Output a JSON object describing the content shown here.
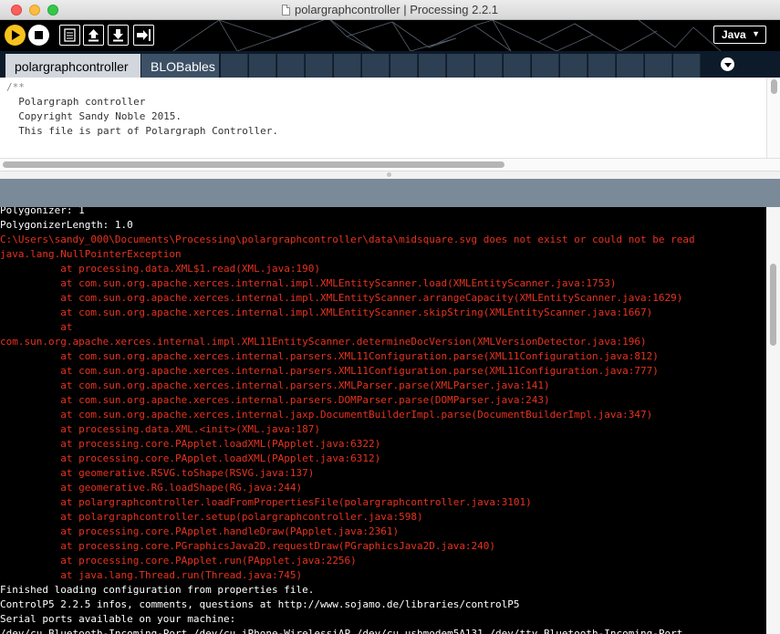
{
  "window": {
    "title": "polargraphcontroller | Processing 2.2.1"
  },
  "toolbar": {
    "run_icon": "run-icon",
    "stop_icon": "stop-icon",
    "new_icon": "new-file-icon",
    "open_icon": "open-arrow-icon",
    "save_icon": "save-arrow-icon",
    "export_icon": "export-icon",
    "mode": "Java",
    "accent": "#f7c21c"
  },
  "tabs": [
    {
      "label": "polargraphcontroller",
      "active": true
    },
    {
      "label": "BLOBables",
      "active": false
    }
  ],
  "editor": {
    "lines": [
      "/**",
      "  Polargraph controller",
      "  Copyright Sandy Noble 2015.",
      "",
      "  This file is part of Polargraph Controller."
    ]
  },
  "console": {
    "lines": [
      {
        "type": "out",
        "text": "Polygonizer: 1"
      },
      {
        "type": "out",
        "text": "PolygonizerLength: 1.0"
      },
      {
        "type": "err",
        "text": "C:\\Users\\sandy_000\\Documents\\Processing\\polargraphcontroller\\data\\midsquare.svg does not exist or could not be read"
      },
      {
        "type": "err",
        "text": "java.lang.NullPointerException"
      },
      {
        "type": "err",
        "text": "          at processing.data.XML$1.read(XML.java:190)"
      },
      {
        "type": "err",
        "text": "          at com.sun.org.apache.xerces.internal.impl.XMLEntityScanner.load(XMLEntityScanner.java:1753)"
      },
      {
        "type": "err",
        "text": "          at com.sun.org.apache.xerces.internal.impl.XMLEntityScanner.arrangeCapacity(XMLEntityScanner.java:1629)"
      },
      {
        "type": "err",
        "text": "          at com.sun.org.apache.xerces.internal.impl.XMLEntityScanner.skipString(XMLEntityScanner.java:1667)"
      },
      {
        "type": "err",
        "text": "          at"
      },
      {
        "type": "err",
        "text": "com.sun.org.apache.xerces.internal.impl.XML11EntityScanner.determineDocVersion(XMLVersionDetector.java:196)"
      },
      {
        "type": "err",
        "text": "          at com.sun.org.apache.xerces.internal.parsers.XML11Configuration.parse(XML11Configuration.java:812)"
      },
      {
        "type": "err",
        "text": "          at com.sun.org.apache.xerces.internal.parsers.XML11Configuration.parse(XML11Configuration.java:777)"
      },
      {
        "type": "err",
        "text": "          at com.sun.org.apache.xerces.internal.parsers.XMLParser.parse(XMLParser.java:141)"
      },
      {
        "type": "err",
        "text": "          at com.sun.org.apache.xerces.internal.parsers.DOMParser.parse(DOMParser.java:243)"
      },
      {
        "type": "err",
        "text": "          at com.sun.org.apache.xerces.internal.jaxp.DocumentBuilderImpl.parse(DocumentBuilderImpl.java:347)"
      },
      {
        "type": "err",
        "text": "          at processing.data.XML.<init>(XML.java:187)"
      },
      {
        "type": "err",
        "text": "          at processing.core.PApplet.loadXML(PApplet.java:6322)"
      },
      {
        "type": "err",
        "text": "          at processing.core.PApplet.loadXML(PApplet.java:6312)"
      },
      {
        "type": "err",
        "text": "          at geomerative.RSVG.toShape(RSVG.java:137)"
      },
      {
        "type": "err",
        "text": "          at geomerative.RG.loadShape(RG.java:244)"
      },
      {
        "type": "err",
        "text": "          at polargraphcontroller.loadFromPropertiesFile(polargraphcontroller.java:3101)"
      },
      {
        "type": "err",
        "text": "          at polargraphcontroller.setup(polargraphcontroller.java:598)"
      },
      {
        "type": "err",
        "text": "          at processing.core.PApplet.handleDraw(PApplet.java:2361)"
      },
      {
        "type": "err",
        "text": "          at processing.core.PGraphicsJava2D.requestDraw(PGraphicsJava2D.java:240)"
      },
      {
        "type": "err",
        "text": "          at processing.core.PApplet.run(PApplet.java:2256)"
      },
      {
        "type": "err",
        "text": "          at java.lang.Thread.run(Thread.java:745)"
      },
      {
        "type": "out",
        "text": "Finished loading configuration from properties file."
      },
      {
        "type": "out",
        "text": "ControlP5 2.2.5 infos, comments, questions at http://www.sojamo.de/libraries/controlP5"
      },
      {
        "type": "out",
        "text": "Serial ports available on your machine:"
      },
      {
        "type": "out",
        "text": "/dev/cu.Bluetooth-Incoming-Port /dev/cu.iPhone-WirelessiAP /dev/cu.usbmodem5A131 /dev/tty.Bluetooth-Incoming-Port"
      }
    ],
    "error_color": "#e8321f",
    "out_color": "#ffffff"
  }
}
